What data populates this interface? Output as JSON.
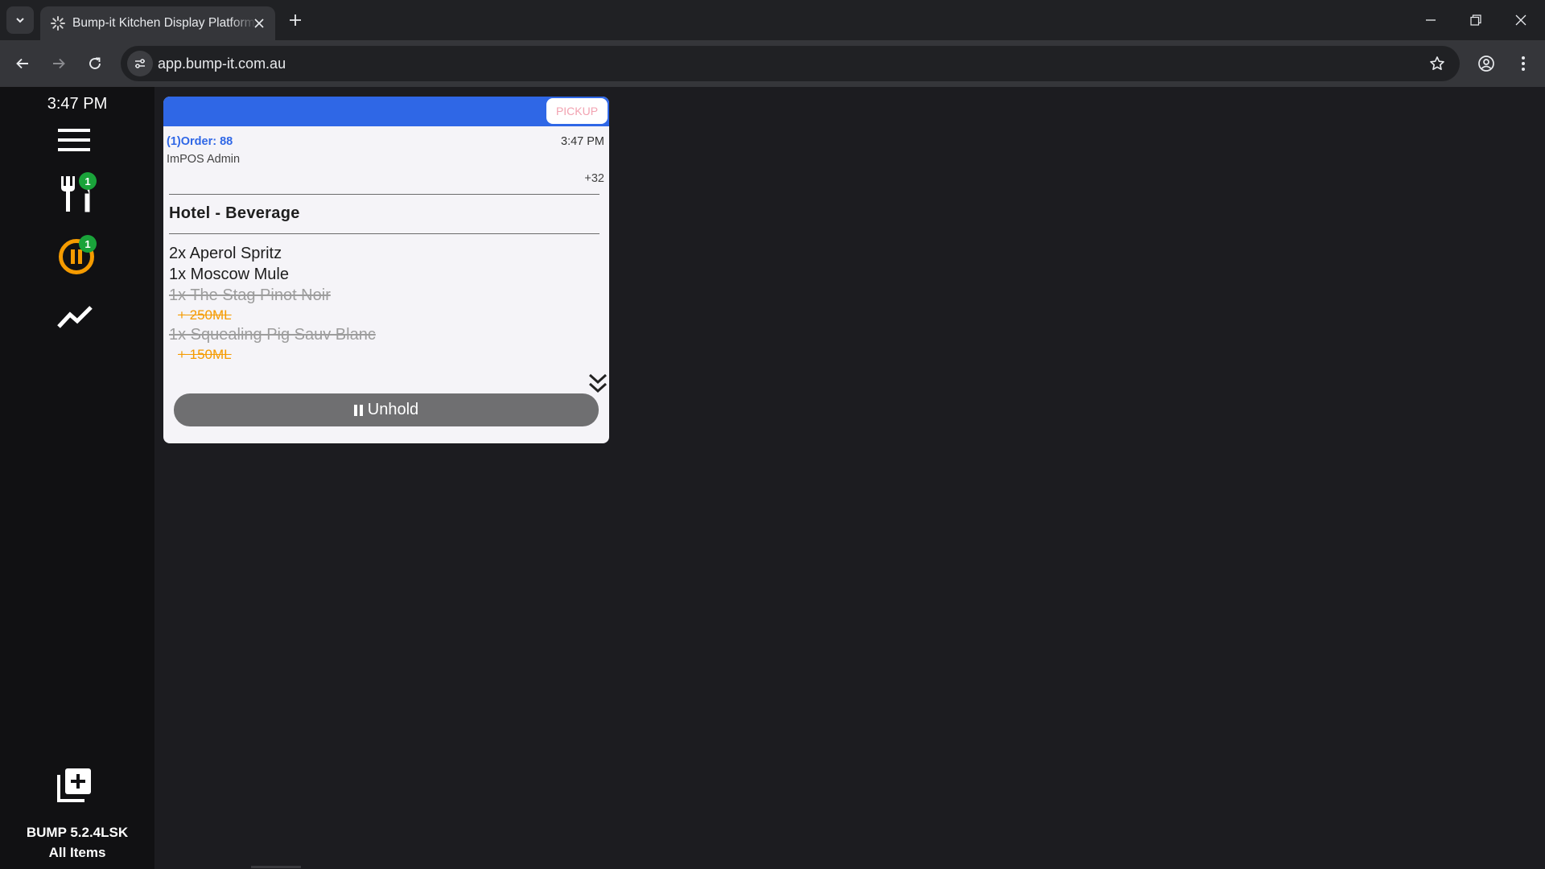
{
  "browser": {
    "tab_title": "Bump-it Kitchen Display Platform",
    "url": "app.bump-it.com.au"
  },
  "sidebar": {
    "clock": "3:47 PM",
    "items": [
      {
        "name": "menu",
        "icon": "hamburger-menu-icon"
      },
      {
        "name": "orders",
        "icon": "fork-knife-icon",
        "badge": "1"
      },
      {
        "name": "on-hold",
        "icon": "pause-circle-icon",
        "badge": "1",
        "color": "#f59b00"
      },
      {
        "name": "analytics",
        "icon": "trend-line-icon"
      }
    ],
    "add_icon": "add-box-icon",
    "version": "BUMP 5.2.4LSK",
    "view": "All Items"
  },
  "order": {
    "header_color": "#2f67e6",
    "type_label": "PICKUP",
    "id_label": "(1)Order: 88",
    "time": "3:47 PM",
    "user": "ImPOS Admin",
    "extra": "+32",
    "section": "Hotel - Beverage",
    "items": [
      {
        "text": "2x Aperol Spritz",
        "struck": false
      },
      {
        "text": "1x Moscow Mule",
        "struck": false
      },
      {
        "text": "1x The Stag Pinot Noir",
        "struck": true,
        "modifier": "+ 250ML"
      },
      {
        "text": "1x Squealing Pig Sauv Blanc",
        "struck": true,
        "modifier": "+ 150ML"
      }
    ],
    "unhold_label": "Unhold"
  }
}
